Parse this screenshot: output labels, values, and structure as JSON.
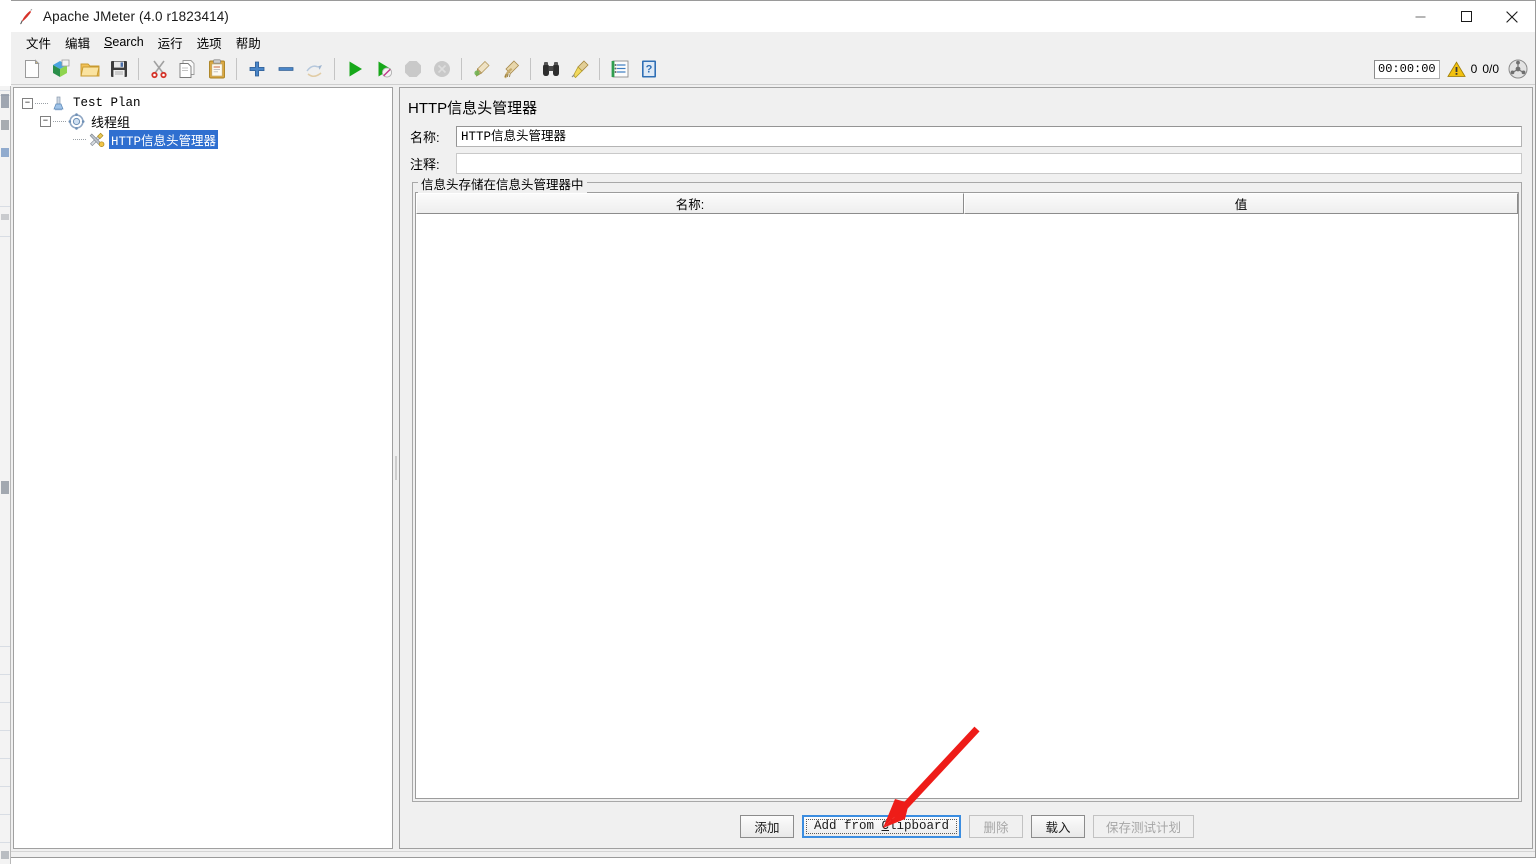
{
  "window": {
    "title": "Apache JMeter (4.0 r1823414)",
    "app_icon": "jmeter-feather-icon",
    "controls": {
      "minimize": "minimize-icon",
      "maximize": "maximize-icon",
      "close": "close-icon"
    }
  },
  "menu": {
    "items": [
      {
        "label": "文件",
        "mnemonic": ""
      },
      {
        "label": "编辑",
        "mnemonic": ""
      },
      {
        "label": "Search",
        "mnemonic": "S"
      },
      {
        "label": "运行",
        "mnemonic": ""
      },
      {
        "label": "选项",
        "mnemonic": ""
      },
      {
        "label": "帮助",
        "mnemonic": ""
      }
    ]
  },
  "toolbar": {
    "buttons": [
      {
        "name": "new-test-plan",
        "icon": "new-document-icon",
        "enabled": true
      },
      {
        "name": "templates",
        "icon": "templates-icon",
        "enabled": true
      },
      {
        "name": "open-test-plan",
        "icon": "open-folder-icon",
        "enabled": true
      },
      {
        "name": "save-test-plan",
        "icon": "save-floppy-icon",
        "enabled": true
      },
      {
        "name": "cut",
        "icon": "scissors-icon",
        "enabled": true
      },
      {
        "name": "copy",
        "icon": "copy-pages-icon",
        "enabled": true
      },
      {
        "name": "paste",
        "icon": "clipboard-icon",
        "enabled": true
      },
      {
        "name": "expand-all",
        "icon": "plus-icon",
        "enabled": true
      },
      {
        "name": "collapse-all",
        "icon": "minus-icon",
        "enabled": true
      },
      {
        "name": "toggle",
        "icon": "toggle-arrows-icon",
        "enabled": true
      },
      {
        "name": "start",
        "icon": "play-green-icon",
        "enabled": true
      },
      {
        "name": "start-no-timers",
        "icon": "play-no-timers-icon",
        "enabled": true
      },
      {
        "name": "stop",
        "icon": "stop-octagon-icon",
        "enabled": false
      },
      {
        "name": "shutdown",
        "icon": "shutdown-circle-icon",
        "enabled": false
      },
      {
        "name": "clear",
        "icon": "clear-broom-icon",
        "enabled": true
      },
      {
        "name": "clear-all",
        "icon": "clear-all-broom-icon",
        "enabled": true
      },
      {
        "name": "search",
        "icon": "binoculars-icon",
        "enabled": true
      },
      {
        "name": "search-reset",
        "icon": "reset-brush-icon",
        "enabled": true
      },
      {
        "name": "function-helper",
        "icon": "function-list-icon",
        "enabled": true
      },
      {
        "name": "help",
        "icon": "help-book-icon",
        "enabled": true
      }
    ],
    "elapsed": "00:00:00",
    "warning_icon": "warning-triangle-icon",
    "warning_count": "0",
    "thread_counts": "0/0",
    "remote_icon": "remote-engine-icon"
  },
  "tree": {
    "nodes": [
      {
        "label": "Test Plan",
        "icon": "test-plan-icon",
        "expanded": true,
        "selected": false,
        "level": 0
      },
      {
        "label": "线程组",
        "icon": "thread-group-icon",
        "expanded": true,
        "selected": false,
        "level": 1
      },
      {
        "label": "HTTP信息头管理器",
        "icon": "header-manager-icon",
        "expanded": false,
        "selected": true,
        "level": 2
      }
    ]
  },
  "detail": {
    "title": "HTTP信息头管理器",
    "name_label": "名称:",
    "name_value": "HTTP信息头管理器",
    "comment_label": "注释:",
    "comment_value": "",
    "group_title": "信息头存储在信息头管理器中",
    "table": {
      "columns": [
        "名称:",
        "值"
      ],
      "rows": []
    },
    "buttons": [
      {
        "name": "add-button",
        "label": "添加",
        "enabled": true,
        "focused": false
      },
      {
        "name": "add-from-clipboard-button",
        "label": "Add from Clipboard",
        "mnemonic": "C",
        "enabled": true,
        "focused": true
      },
      {
        "name": "delete-button",
        "label": "删除",
        "enabled": false,
        "focused": false
      },
      {
        "name": "load-button",
        "label": "载入",
        "enabled": true,
        "focused": false
      },
      {
        "name": "save-test-plan-button",
        "label": "保存测试计划",
        "enabled": false,
        "focused": false
      }
    ]
  },
  "annotation": {
    "arrow_color": "#ee1c18",
    "target": "add-from-clipboard-button"
  },
  "colors": {
    "window_bg": "#f0f0f0",
    "panel_bg": "#ffffff",
    "selection_blue": "#2f6fd0",
    "focus_blue": "#3b8de0",
    "annotation_red": "#ee1c18",
    "border_gray": "#a0a0a0"
  }
}
